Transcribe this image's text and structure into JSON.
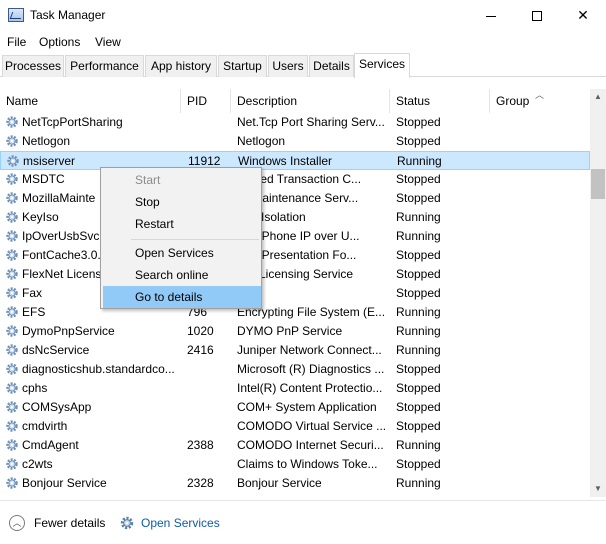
{
  "window": {
    "title": "Task Manager"
  },
  "menu": [
    "File",
    "Options",
    "View"
  ],
  "tabs": [
    "Processes",
    "Performance",
    "App history",
    "Startup",
    "Users",
    "Details",
    "Services"
  ],
  "active_tab": "Services",
  "columns": {
    "name": "Name",
    "pid": "PID",
    "description": "Description",
    "status": "Status",
    "group": "Group"
  },
  "rows": [
    {
      "name": "NetTcpPortSharing",
      "pid": "",
      "description": "Net.Tcp Port Sharing Serv...",
      "status": "Stopped"
    },
    {
      "name": "Netlogon",
      "pid": "",
      "description": "Netlogon",
      "status": "Stopped"
    },
    {
      "name": "msiserver",
      "pid": "11912",
      "description": "Windows Installer",
      "status": "Running"
    },
    {
      "name": "MSDTC",
      "pid": "",
      "description": "ributed Transaction C...",
      "status": "Stopped"
    },
    {
      "name": "MozillaMainte",
      "pid": "",
      "description": "lla Maintenance Serv...",
      "status": "Stopped"
    },
    {
      "name": "KeyIso",
      "pid": "",
      "description": "Key Isolation",
      "status": "Running"
    },
    {
      "name": "IpOverUsbSvc",
      "pid": "",
      "description": "ows Phone IP over U...",
      "status": "Running"
    },
    {
      "name": "FontCache3.0.",
      "pid": "",
      "description": "ows Presentation Fo...",
      "status": "Stopped"
    },
    {
      "name": "FlexNet Licens",
      "pid": "",
      "description": "Net Licensing Service",
      "status": "Stopped"
    },
    {
      "name": "Fax",
      "pid": "",
      "description": "",
      "status": "Stopped"
    },
    {
      "name": "EFS",
      "pid": "796",
      "description": "Encrypting File System (E...",
      "status": "Running"
    },
    {
      "name": "DymoPnpService",
      "pid": "1020",
      "description": "DYMO PnP Service",
      "status": "Running"
    },
    {
      "name": "dsNcService",
      "pid": "2416",
      "description": "Juniper Network Connect...",
      "status": "Running"
    },
    {
      "name": "diagnosticshub.standardco...",
      "pid": "",
      "description": "Microsoft (R) Diagnostics ...",
      "status": "Stopped"
    },
    {
      "name": "cphs",
      "pid": "",
      "description": "Intel(R) Content Protectio...",
      "status": "Stopped"
    },
    {
      "name": "COMSysApp",
      "pid": "",
      "description": "COM+ System Application",
      "status": "Stopped"
    },
    {
      "name": "cmdvirth",
      "pid": "",
      "description": "COMODO Virtual Service ...",
      "status": "Stopped"
    },
    {
      "name": "CmdAgent",
      "pid": "2388",
      "description": "COMODO Internet Securi...",
      "status": "Running"
    },
    {
      "name": "c2wts",
      "pid": "",
      "description": "Claims to Windows Toke...",
      "status": "Stopped"
    },
    {
      "name": "Bonjour Service",
      "pid": "2328",
      "description": "Bonjour Service",
      "status": "Running"
    }
  ],
  "selected_row": "msiserver",
  "context_menu": {
    "start": "Start",
    "stop": "Stop",
    "restart": "Restart",
    "open_services": "Open Services",
    "search_online": "Search online",
    "go_to_details": "Go to details"
  },
  "footer": {
    "fewer_details": "Fewer details",
    "open_services": "Open Services"
  },
  "colors": {
    "selection": "#cce8ff",
    "menu_hover": "#91c9f7",
    "link": "#0b5cad"
  },
  "icons": {
    "service": "gear-icon",
    "app": "task-manager-icon"
  }
}
